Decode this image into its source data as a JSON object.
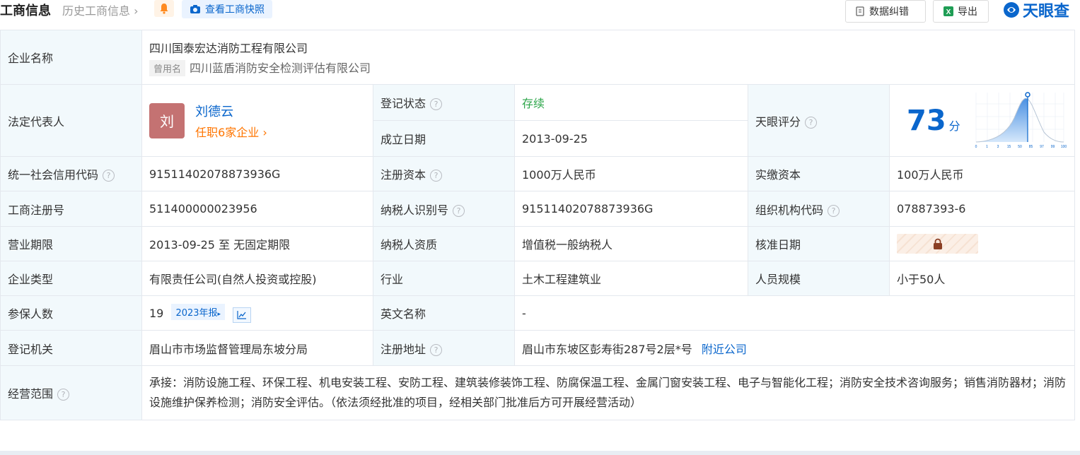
{
  "header": {
    "title": "工商信息",
    "history": "历史工商信息",
    "snapshot": "查看工商快照",
    "error_btn": "数据纠错",
    "export_btn": "导出",
    "brand": "天眼查"
  },
  "company": {
    "name_label": "企业名称",
    "name": "四川国泰宏达消防工程有限公司",
    "former_tag": "曾用名",
    "former_name": "四川蓝盾消防安全检测评估有限公司"
  },
  "rep": {
    "label": "法定代表人",
    "avatar": "刘",
    "name": "刘德云",
    "jobs": "任职6家企业"
  },
  "status": {
    "label": "登记状态",
    "value": "存续"
  },
  "found": {
    "label": "成立日期",
    "value": "2013-09-25"
  },
  "score": {
    "label": "天眼评分",
    "value": "73",
    "unit": "分",
    "axis_ticks": [
      "0",
      "1",
      "3",
      "15",
      "50",
      "85",
      "97",
      "99",
      "100"
    ]
  },
  "credit": {
    "label": "统一社会信用代码",
    "value": "91511402078873936G"
  },
  "reg_capital": {
    "label": "注册资本",
    "value": "1000万人民币"
  },
  "paid_capital": {
    "label": "实缴资本",
    "value": "100万人民币"
  },
  "reg_no": {
    "label": "工商注册号",
    "value": "511400000023956"
  },
  "taxpayer_id": {
    "label": "纳税人识别号",
    "value": "91511402078873936G"
  },
  "org_code": {
    "label": "组织机构代码",
    "value": "07887393-6"
  },
  "term": {
    "label": "营业期限",
    "value": "2013-09-25 至 无固定期限"
  },
  "tax_quality": {
    "label": "纳税人资质",
    "value": "增值税一般纳税人"
  },
  "approve_date": {
    "label": "核准日期"
  },
  "type": {
    "label": "企业类型",
    "value": "有限责任公司(自然人投资或控股)"
  },
  "industry": {
    "label": "行业",
    "value": "土木工程建筑业"
  },
  "staff": {
    "label": "人员规模",
    "value": "小于50人"
  },
  "insured": {
    "label": "参保人数",
    "value": "19",
    "year_btn": "2023年报"
  },
  "english": {
    "label": "英文名称",
    "value": "-"
  },
  "authority": {
    "label": "登记机关",
    "value": "眉山市市场监督管理局东坡分局"
  },
  "address": {
    "label": "注册地址",
    "value": "眉山市东坡区彭寿街287号2层*号",
    "nearby": "附近公司"
  },
  "scope": {
    "label": "经营范围",
    "value": "承接：消防设施工程、环保工程、机电安装工程、安防工程、建筑装修装饰工程、防腐保温工程、金属门窗安装工程、电子与智能化工程；消防安全技术咨询服务；销售消防器材；消防设施维护保养检测；消防安全评估。（依法须经批准的项目，经相关部门批准后方可开展经营活动）"
  },
  "colors": {
    "accent": "#0a66cc",
    "label_bg": "#f2f9fc",
    "green": "#2da64a",
    "orange": "#ff7500"
  }
}
